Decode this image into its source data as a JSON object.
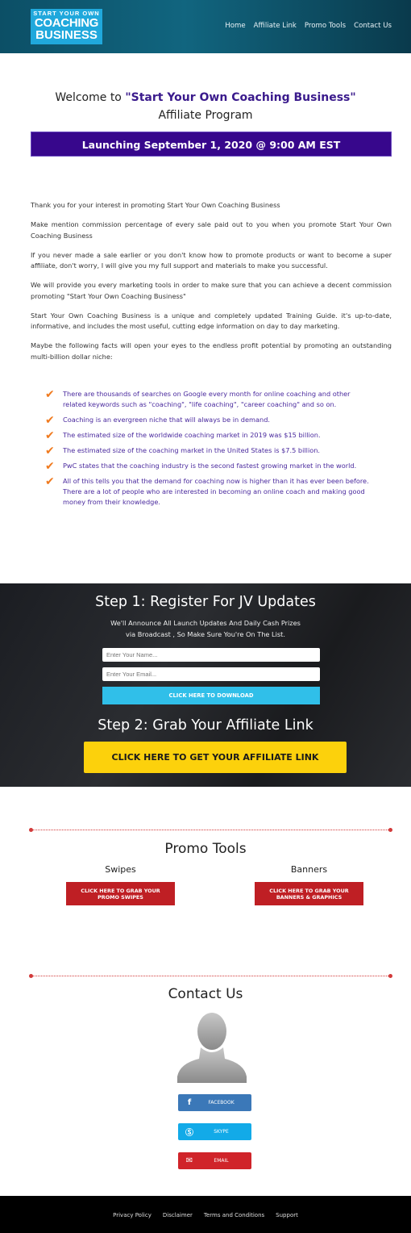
{
  "header": {
    "logo_text": [
      "START YOUR OWN",
      "COACHING",
      "BUSINESS"
    ],
    "nav": [
      "Home",
      "Affiliate Link",
      "Promo Tools",
      "Contact Us"
    ]
  },
  "hero": {
    "welcome_prefix": "Welcome to ",
    "welcome_highlight": "\"Start Your Own Coaching Business\"",
    "subtitle": "Affiliate Program",
    "launch": "Launching September 1, 2020 @ 9:00 AM EST"
  },
  "intro": [
    "Thank you for your interest in promoting Start Your Own Coaching Business",
    "Make mention commission percentage of every sale paid out to you when you promote Start Your Own Coaching Business",
    "If you never made a sale earlier or you don't know how to promote products or want to become a super affiliate, don't worry, I will give you my full support and materials to make you successful.",
    "We will provide you every marketing tools in order to make sure that you can achieve a decent commission promoting \"Start Your Own Coaching Business\"",
    "Start Your Own Coaching Business is a unique and completely updated Training Guide. it's up-to-date, informative, and includes the most useful, cutting edge information on day to day marketing.",
    "Maybe the following facts will open your eyes to the endless profit potential by promoting an outstanding multi-billion dollar niche:"
  ],
  "facts": [
    "There are thousands of searches on Google every month for online coaching and other related keywords such as \"coaching\", \"life coaching\", \"career coaching\" and so on.",
    "Coaching is an evergreen niche that will always be in demand.",
    "The estimated size of the worldwide coaching market in 2019 was $15 billion.",
    "The estimated size of the coaching market in the United States is $7.5 billion.",
    "PwC states that the coaching industry is the second fastest growing market in the world.",
    "All of this tells you that the demand for coaching now is higher than it has ever been before. There are a lot of people who are interested in becoming an online coach and making good money from their knowledge."
  ],
  "jv": {
    "step1": "Step 1: Register For JV Updates",
    "announce_1": "We'll Announce All Launch Updates And Daily Cash Prizes",
    "announce_2": "via Broadcast , So Make Sure You're On The List.",
    "name_placeholder": "Enter Your Name...",
    "email_placeholder": "Enter Your Email...",
    "download": "CLICK HERE TO DOWNLOAD",
    "step2": "Step 2: Grab Your Affiliate Link",
    "affiliate": "CLICK HERE TO GET YOUR AFFILIATE LINK"
  },
  "promo": {
    "title": "Promo Tools",
    "swipes": "Swipes",
    "swipes_btn": "CLICK HERE TO GRAB YOUR PROMO SWIPES",
    "banners": "Banners",
    "banners_btn": "CLICK HERE TO GRAB YOUR BANNERS & GRAPHICS"
  },
  "contact": {
    "title": "Contact Us",
    "facebook": "FACEBOOK",
    "skype": "SKYPE",
    "email": "EMAIL"
  },
  "footer": [
    "Privacy Policy",
    "Disclaimer",
    "Terms and Conditions",
    "Support"
  ],
  "colors": {
    "launch_bar": "#37078c",
    "facts_text": "#4a2a9e",
    "check": "#f07a1e",
    "download": "#30bfe9",
    "affiliate": "#fcd10c",
    "promo_btn": "#bf1f24",
    "facebook": "#3b78b8",
    "skype": "#12aae8",
    "email": "#d0242a"
  }
}
